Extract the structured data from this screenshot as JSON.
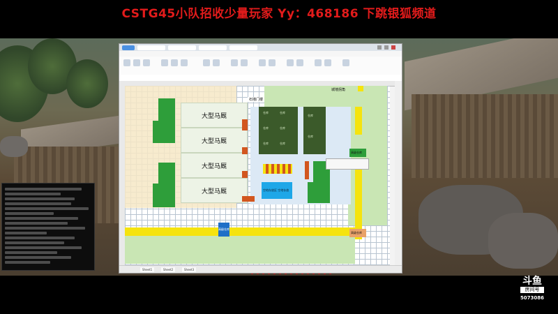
{
  "banner": {
    "text": "CSTG45小队招收少量玩家 Yy：468186 下跳银狐频道",
    "color": "#e21b1b"
  },
  "spreadsheet": {
    "window_tabs": [
      "",
      "",
      "",
      ""
    ],
    "sheet_tabs": [
      "Sheet1",
      "Sheet2",
      "Sheet3"
    ],
    "labels": {
      "stable_1": "大型马厩",
      "stable_2": "大型马厩",
      "stable_3": "大型马厩",
      "stable_4": "大型马厩",
      "top_gate": "石墙门楼",
      "corner_note": "城墙拐角",
      "right_building": "高级仓库",
      "blue_block": "空地存放区  空地存放",
      "bottom_blue": "高级仓库",
      "bottom_right": "高级仓库"
    },
    "small_cell_text": "仓库",
    "colors": {
      "stable_fill": "#edf3e6",
      "green": "#2e9e3a",
      "dark_green": "#3b5a2a",
      "orange": "#d2561f",
      "yellow": "#f5e30e",
      "light_green": "#c9e6b4",
      "blue": "#1ea7e8",
      "beige": "#f6e8c6"
    }
  },
  "watermark": {
    "brand": "斗鱼",
    "room_label": "房间号",
    "room_number": "5073086"
  }
}
